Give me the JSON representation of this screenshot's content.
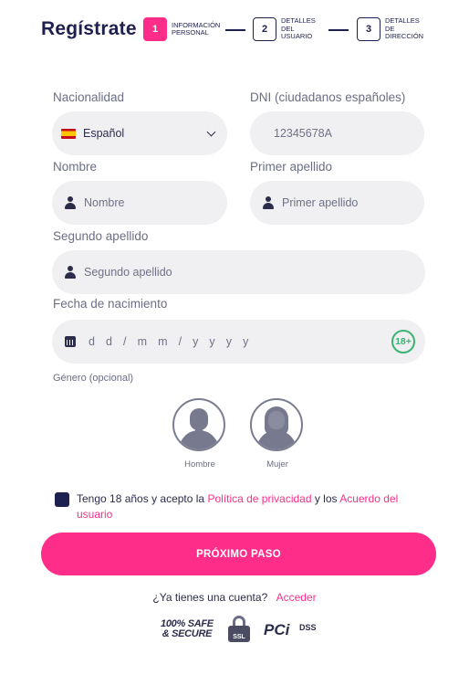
{
  "header": {
    "title": "Regístrate",
    "steps": [
      {
        "number": "1",
        "line1": "INFORMACIÓN",
        "line2": "PERSONAL",
        "line3": ""
      },
      {
        "number": "2",
        "line1": "DETALLES",
        "line2": "DEL",
        "line3": "USUARIO"
      },
      {
        "number": "3",
        "line1": "DETALLES",
        "line2": "DE",
        "line3": "DIRECCIÓN"
      }
    ],
    "active_step": "1"
  },
  "form": {
    "nationality": {
      "label": "Nacionalidad",
      "value": "Español"
    },
    "dni": {
      "label": "DNI (ciudadanos españoles)",
      "placeholder": "12345678A"
    },
    "first_name": {
      "label": "Nombre",
      "placeholder": "Nombre"
    },
    "last_name_1": {
      "label": "Primer apellido",
      "placeholder": "Primer apellido"
    },
    "last_name_2": {
      "label": "Segundo apellido",
      "placeholder": "Segundo apellido"
    },
    "birth_date": {
      "label": "Fecha de nacimiento",
      "placeholder": "d d / m m / y y y y",
      "badge": "18+"
    },
    "gender": {
      "label": "Género (opcional)",
      "options": [
        "Hombre",
        "Mujer"
      ]
    },
    "consent": {
      "text_before": "Tengo 18 años y acepto la ",
      "privacy_link": "Política de privacidad",
      "text_middle": " y los ",
      "terms_link": "Acuerdo del usuario"
    },
    "submit_label": "PRÓXIMO PASO"
  },
  "login": {
    "question": "¿Ya tienes una cuenta?",
    "link": "Acceder"
  },
  "trust": {
    "safe_line1": "100% SAFE",
    "safe_line2": "& SECURE",
    "ssl": "SSL",
    "pci": "PCi",
    "dss": "DSS"
  },
  "colors": {
    "accent": "#ff2d8a",
    "navy": "#1e2150",
    "field_bg": "#f0f0f2",
    "badge_green": "#3cb371"
  }
}
